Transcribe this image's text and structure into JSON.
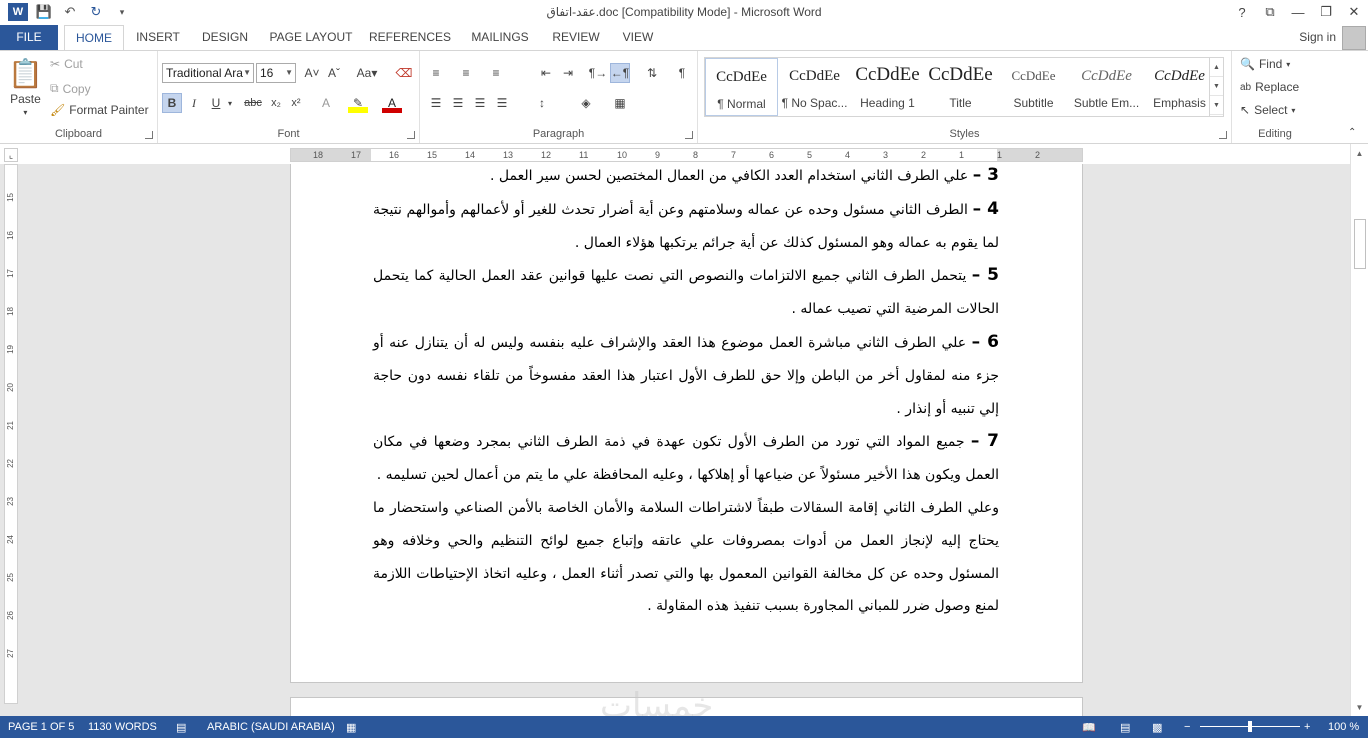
{
  "window": {
    "title": "عقد-اتفاق.doc [Compatibility Mode] - Microsoft Word",
    "controls": [
      "?",
      "⧉",
      "—",
      "❐",
      "✕"
    ]
  },
  "tabs": [
    {
      "label": "FILE",
      "active": false
    },
    {
      "label": "HOME",
      "active": true
    },
    {
      "label": "INSERT",
      "active": false
    },
    {
      "label": "DESIGN",
      "active": false
    },
    {
      "label": "PAGE LAYOUT",
      "active": false
    },
    {
      "label": "REFERENCES",
      "active": false
    },
    {
      "label": "MAILINGS",
      "active": false
    },
    {
      "label": "REVIEW",
      "active": false
    },
    {
      "label": "VIEW",
      "active": false
    }
  ],
  "account": {
    "signin_label": "Sign in"
  },
  "clipboard": {
    "label": "Clipboard",
    "paste": "Paste",
    "cut": "Cut",
    "copy": "Copy",
    "format_painter": "Format Painter"
  },
  "font": {
    "label": "Font",
    "family": "Traditional Ara",
    "size": "16"
  },
  "paragraph": {
    "label": "Paragraph"
  },
  "styles": {
    "label": "Styles",
    "items": [
      {
        "preview": "CcDdEe",
        "name": "¶ Normal"
      },
      {
        "preview": "CcDdEe",
        "name": "¶ No Spac..."
      },
      {
        "preview": "CcDdEe",
        "name": "Heading 1"
      },
      {
        "preview": "CcDdEe",
        "name": "Title"
      },
      {
        "preview": "CcDdEe",
        "name": "Subtitle"
      },
      {
        "preview": "CcDdEe",
        "name": "Subtle Em..."
      },
      {
        "preview": "CcDdEe",
        "name": "Emphasis"
      }
    ]
  },
  "editing": {
    "label": "Editing",
    "find": "Find",
    "replace": "Replace",
    "select": "Select"
  },
  "ruler": {
    "ticks": [
      "18",
      "17",
      "16",
      "15",
      "14",
      "13",
      "12",
      "11",
      "10",
      "9",
      "8",
      "7",
      "6",
      "5",
      "4",
      "3",
      "2",
      "1",
      "1",
      "2"
    ],
    "vticks": [
      "15",
      "16",
      "17",
      "18",
      "19",
      "20",
      "21",
      "22",
      "23",
      "24",
      "25",
      "26",
      "27"
    ]
  },
  "document": {
    "paragraphs": [
      {
        "num": "3 –",
        "text": " علي الطرف الثاني استخدام العدد الكافي من العمال المختصين لحسن سير العمل ."
      },
      {
        "num": "4 –",
        "text": " الطرف الثاني مسئول وحده عن عماله وسلامتهم وعن أية أضرار تحدث للغير أو لأعمالهم وأموالهم نتيجة لما يقوم به عماله وهو المسئول كذلك عن أية جرائم يرتكبها هؤلاء العمال ."
      },
      {
        "num": "5 –",
        "text": " يتحمل الطرف الثاني جميع الالتزامات والنصوص التي نصت عليها قوانين عقد العمل الحالية كما يتحمل الحالات المرضية التي تصيب عماله ."
      },
      {
        "num": "6 –",
        "text": " علي الطرف الثاني مباشرة العمل موضوع هذا العقد والإشراف عليه بنفسه وليس له أن يتنازل عنه أو جزء منه لمقاول أخر من الباطن وإلا حق للطرف الأول اعتبار هذا العقد مفسوخاً من تلقاء نفسه دون حاجة إلي تنبيه أو إنذار ."
      },
      {
        "num": "7 –",
        "text": " جميع المواد التي تورد من الطرف الأول تكون عهدة في ذمة الطرف الثاني بمجرد وضعها في مكان العمل ويكون هذا الأخير مسئولاً عن ضياعها أو إهلاكها ، وعليه المحافظة علي ما يتم من أعمال لحين تسليمه ."
      },
      {
        "num": "",
        "text": "وعلي الطرف الثاني إقامة السقالات طبقاً لاشتراطات السلامة والأمان الخاصة بالأمن الصناعي واستحضار ما يحتاج إليه لإنجاز العمل من أدوات بمصروفات علي عاتقه وإتباع جميع لوائح التنظيم والحي وخلافه وهو المسئول وحده عن كل مخالفة القوانين المعمول بها والتي تصدر أثناء العمل ، وعليه اتخاذ الإحتياطات اللازمة لمنع وصول ضرر للمباني المجاورة بسبب تنفيذ هذه المقاولة ."
      }
    ]
  },
  "status": {
    "page": "PAGE 1 OF 5",
    "words": "1130 WORDS",
    "language": "ARABIC (SAUDI ARABIA)",
    "zoom": "100 %",
    "zoom_fraction": 0.5
  },
  "watermark": "خمسات",
  "colors": {
    "accent": "#2b579a"
  }
}
